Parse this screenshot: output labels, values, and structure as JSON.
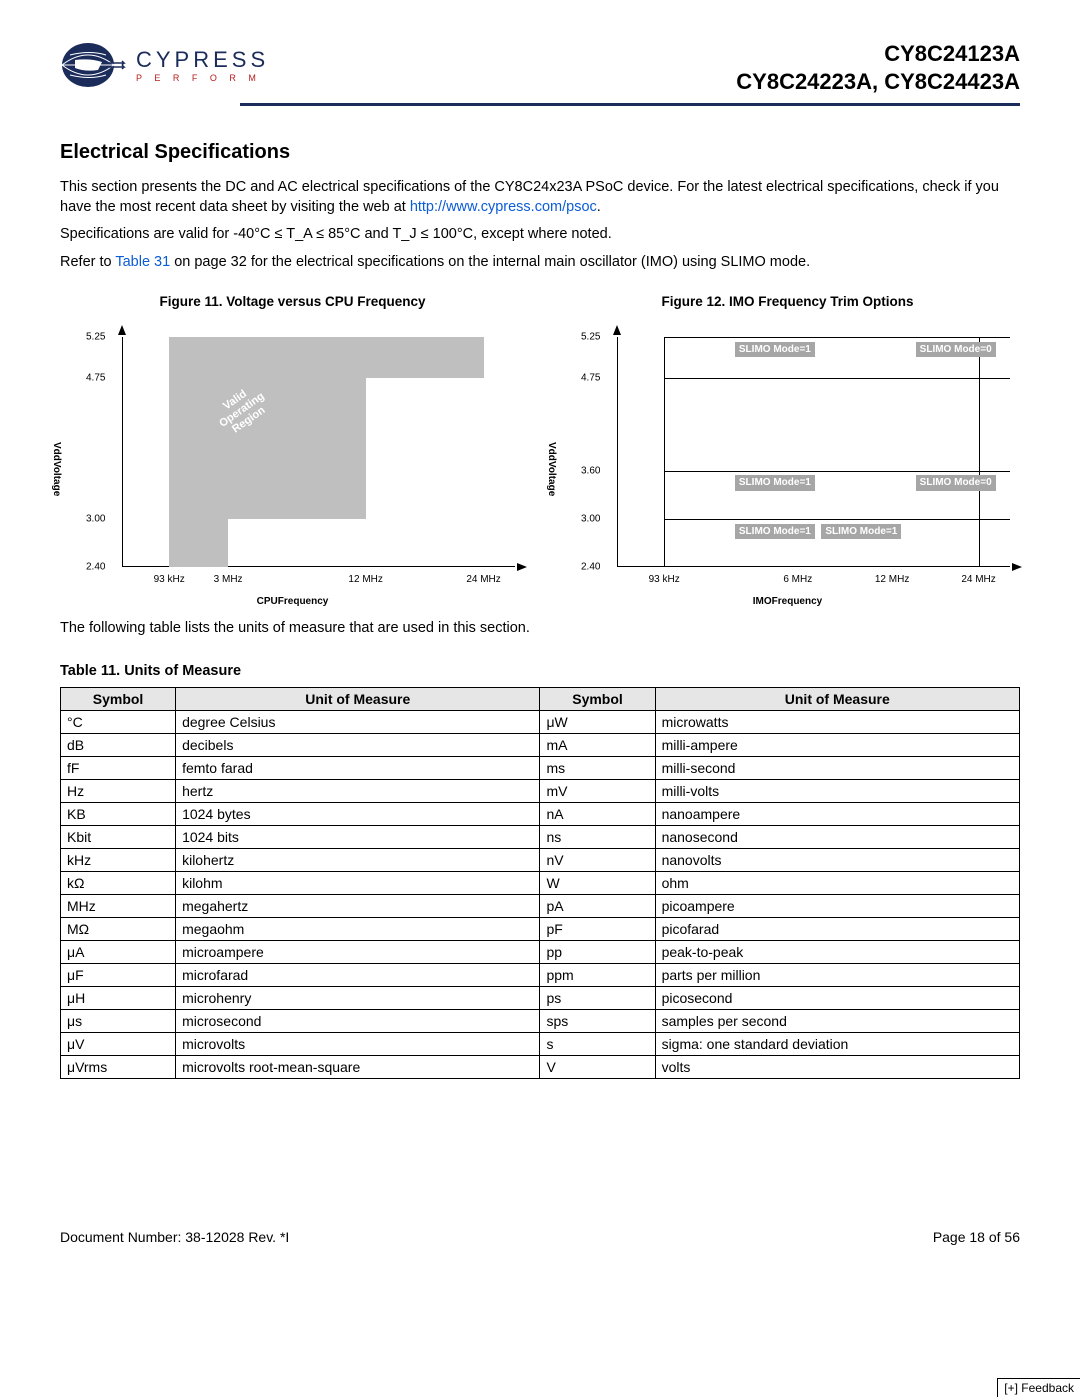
{
  "header": {
    "logo_brand": "CYPRESS",
    "logo_sub": "P E R F O R M",
    "part1": "CY8C24123A",
    "part2": "CY8C24223A, CY8C24423A"
  },
  "section_title": "Electrical Specifications",
  "para1a": "This section presents the DC and AC electrical specifications of the CY8C24x23A PSoC device. For the latest electrical specifications, check if you have the most recent data sheet by visiting the web at ",
  "para1_link": "http://www.cypress.com/psoc",
  "para1b": ".",
  "para2": "Specifications are valid for -40°C ≤ T_A ≤ 85°C and T_J ≤ 100°C, except where noted.",
  "para3a": "Refer to ",
  "para3_link": "Table 31",
  "para3b": " on page 32 for the electrical specifications on the internal main oscillator (IMO) using SLIMO mode.",
  "fig11_title": "Figure 11.  Voltage versus CPU Frequency",
  "fig12_title": "Figure 12.  IMO Frequency Trim Options",
  "after_figs": "The following table lists the units of measure that are used in this section.",
  "table_caption": "Table 11.  Units of Measure",
  "th": {
    "sym": "Symbol",
    "uom": "Unit of Measure"
  },
  "rows": [
    [
      "°C",
      "degree Celsius",
      "μW",
      "microwatts"
    ],
    [
      "dB",
      "decibels",
      "mA",
      "milli-ampere"
    ],
    [
      "fF",
      "femto farad",
      "ms",
      "milli-second"
    ],
    [
      "Hz",
      "hertz",
      "mV",
      "milli-volts"
    ],
    [
      "KB",
      "1024 bytes",
      "nA",
      "nanoampere"
    ],
    [
      "Kbit",
      "1024 bits",
      "ns",
      "nanosecond"
    ],
    [
      "kHz",
      "kilohertz",
      "nV",
      "nanovolts"
    ],
    [
      "kΩ",
      "kilohm",
      "W",
      "ohm"
    ],
    [
      "MHz",
      "megahertz",
      "pA",
      "picoampere"
    ],
    [
      "MΩ",
      "megaohm",
      "pF",
      "picofarad"
    ],
    [
      "μA",
      "microampere",
      "pp",
      "peak-to-peak"
    ],
    [
      "μF",
      "microfarad",
      "ppm",
      "parts per million"
    ],
    [
      "μH",
      "microhenry",
      "ps",
      "picosecond"
    ],
    [
      "μs",
      "microsecond",
      "sps",
      "samples per second"
    ],
    [
      "μV",
      "microvolts",
      "s",
      "sigma: one standard deviation"
    ],
    [
      "μVrms",
      "microvolts root-mean-square",
      "V",
      "volts"
    ]
  ],
  "chart_data": [
    {
      "type": "area",
      "title": "Voltage versus CPU Frequency",
      "xlabel": "CPUFrequency",
      "ylabel": "VddVoltage",
      "x_ticks": [
        "93 kHz",
        "3 MHz",
        "12 MHz",
        "24 MHz"
      ],
      "y_ticks": [
        2.4,
        3.0,
        4.75,
        5.25
      ],
      "ylim": [
        2.4,
        5.25
      ],
      "valid_region_polygon_notes": "Valid Operating Region: CPU 93kHz–3MHz at Vdd 2.40–5.25; CPU 3MHz–12MHz at Vdd 3.00–5.25; CPU 12MHz–24MHz at Vdd 4.75–5.25",
      "annotation": "Valid Operating Region"
    },
    {
      "type": "table",
      "title": "IMO Frequency Trim Options",
      "xlabel": "IMOFrequency",
      "ylabel": "VddVoltage",
      "x_ticks": [
        "93 kHz",
        "6 MHz",
        "12 MHz",
        "24 MHz"
      ],
      "y_ticks": [
        2.4,
        3.0,
        3.6,
        4.75,
        5.25
      ],
      "ylim": [
        2.4,
        5.25
      ],
      "cells": [
        {
          "vdd_range": [
            4.75,
            5.25
          ],
          "freq": "6 MHz",
          "label": "SLIMO Mode=1"
        },
        {
          "vdd_range": [
            4.75,
            5.25
          ],
          "freq": "24 MHz",
          "label": "SLIMO Mode=0"
        },
        {
          "vdd_range": [
            3.0,
            3.6
          ],
          "freq": "6 MHz",
          "label": "SLIMO Mode=1"
        },
        {
          "vdd_range": [
            3.0,
            3.6
          ],
          "freq": "24 MHz",
          "label": "SLIMO Mode=0"
        },
        {
          "vdd_range": [
            2.4,
            3.0
          ],
          "freq": "6 MHz",
          "label": "SLIMO Mode=1"
        },
        {
          "vdd_range": [
            2.4,
            3.0
          ],
          "freq": "12 MHz",
          "label": "SLIMO Mode=1"
        }
      ]
    }
  ],
  "axis_labels": {
    "vdd": "VddVoltage",
    "cpu": "CPUFrequency",
    "imo": "IMOFrequency"
  },
  "y_ticks_f11": {
    "t525": "5.25",
    "t475": "4.75",
    "t300": "3.00",
    "t240": "2.40"
  },
  "x_ticks_f11": {
    "t93": "93 kHz",
    "t3": "3 MHz",
    "t12": "12 MHz",
    "t24": "24 MHz"
  },
  "y_ticks_f12": {
    "t525": "5.25",
    "t475": "4.75",
    "t360": "3.60",
    "t300": "3.00",
    "t240": "2.40"
  },
  "x_ticks_f12": {
    "t93": "93 kHz",
    "t6": "6 MHz",
    "t12": "12 MHz",
    "t24": "24 MHz"
  },
  "region_label": "Valid\nOperating\nRegion",
  "slimo1": "SLIMO\nMode=1",
  "slimo0": "SLIMO\nMode=0",
  "footer": {
    "docnum": "Document Number: 38-12028  Rev. *I",
    "page": "Page 18 of 56"
  },
  "feedback": "[+] Feedback"
}
